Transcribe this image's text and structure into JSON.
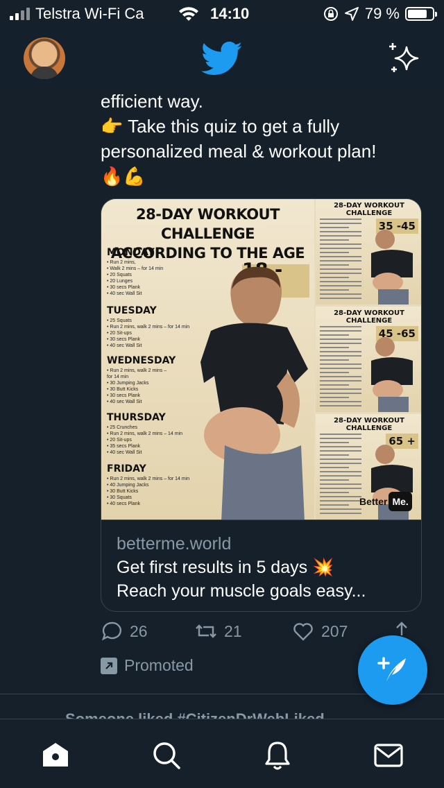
{
  "status_bar": {
    "carrier": "Telstra Wi-Fi Ca",
    "time": "14:10",
    "battery_text": "79 %",
    "battery_level": 0.79
  },
  "header": {
    "logo_icon": "twitter-bird-icon",
    "sparkle_icon": "sparkle-icon",
    "brand_color": "#1d9bf0"
  },
  "tweet": {
    "text_lines": [
      "efficient way.",
      "👉 Take this quiz to get a fully",
      "personalized meal & workout plan!",
      "🔥💪"
    ],
    "card": {
      "main_title_line1": "28-DAY WORKOUT CHALLENGE",
      "main_title_line2": "ACCORDING TO THE AGE",
      "main_age": "18 - 35",
      "days": [
        {
          "name": "MONDAY",
          "items": [
            "• Run 2 mins,",
            "• Walk 2 mins – for 14 min",
            "• 20 Squats",
            "• 20 Lunges",
            "• 30 secs Plank",
            "• 40 sec Wall Sit"
          ]
        },
        {
          "name": "TUESDAY",
          "items": [
            "• 25 Squats",
            "• Run 2 mins, walk 2 mins – for 14 min",
            "• 20 Sit-ups",
            "• 30 secs Plank",
            "• 40 sec Wall Sit"
          ]
        },
        {
          "name": "WEDNESDAY",
          "items": [
            "• Run 2 mins, walk 2 mins –",
            "  for 14 min",
            "• 30 Jumping Jacks",
            "• 30 Butt Kicks",
            "• 30 secs Plank",
            "• 40 sec Wall Sit"
          ]
        },
        {
          "name": "THURSDAY",
          "items": [
            "• 25 Crunches",
            "• Run 2 mins, walk 2 mins – 14 min",
            "• 20 Sit-ups",
            "• 35 secs Plank",
            "• 40 sec Wall Sit"
          ]
        },
        {
          "name": "FRIDAY",
          "items": [
            "• Run 2 mins, walk 2 mins – for 14 min",
            "• 40 Jumping Jacks",
            "• 30 Butt Kicks",
            "• 30 Squats",
            "• 40 secs Plank"
          ]
        }
      ],
      "side_panels": [
        {
          "title": "28-DAY WORKOUT CHALLENGE",
          "age": "35 -45"
        },
        {
          "title": "28-DAY WORKOUT CHALLENGE",
          "age": "45 -65"
        },
        {
          "title": "28-DAY WORKOUT CHALLENGE",
          "age": "65 +"
        }
      ],
      "logo_text_a": "Better",
      "logo_text_b": "Me.",
      "domain": "betterme.world",
      "line1": "Get first results in 5 days 💥",
      "line2": "Reach your muscle goals easy..."
    },
    "actions": {
      "replies": "26",
      "retweets": "21",
      "likes": "207"
    },
    "promoted_label": "Promoted"
  },
  "next_tweet_peek": "Someone liked #CitizenDrWebLiked",
  "tab_bar": {
    "icons": [
      "home-icon",
      "search-icon",
      "notifications-icon",
      "messages-icon"
    ]
  }
}
